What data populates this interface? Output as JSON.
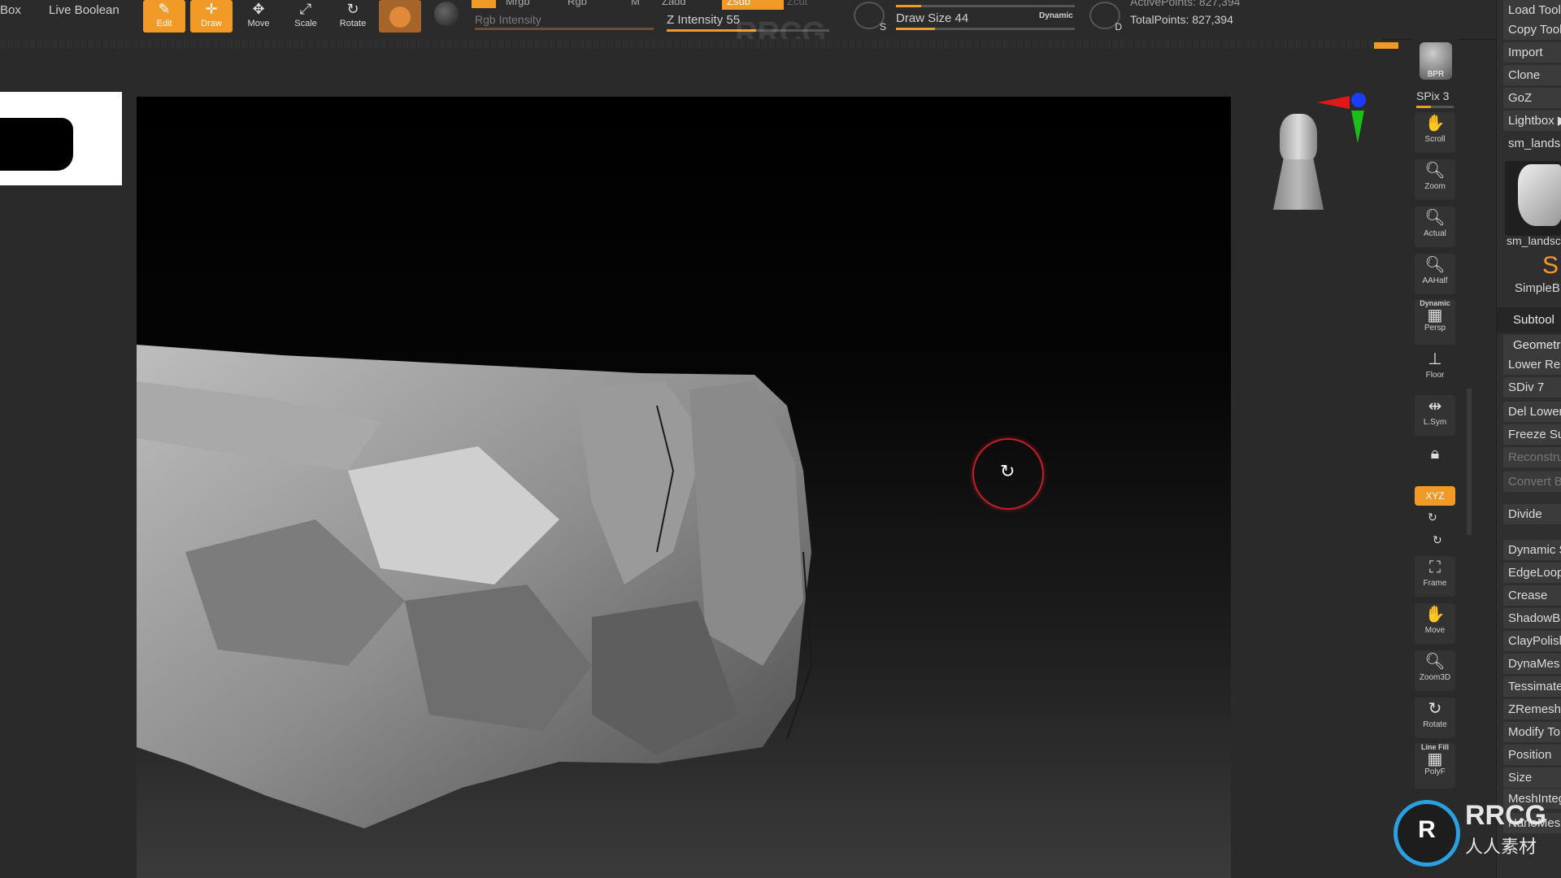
{
  "topbar": {
    "box_label": "Box",
    "live_boolean": "Live Boolean",
    "tools": [
      {
        "label": "Edit",
        "icon": "edit-icon",
        "active": true
      },
      {
        "label": "Draw",
        "icon": "draw-icon",
        "active": true
      },
      {
        "label": "Move",
        "icon": "move-icon",
        "active": false
      },
      {
        "label": "Scale",
        "icon": "scale-icon",
        "active": false
      },
      {
        "label": "Rotate",
        "icon": "rotate-icon",
        "active": false
      }
    ],
    "mrgb": "Mrgb",
    "rgb": "Rgb",
    "m": "M",
    "zadd": "Zadd",
    "zsub": "Zsub",
    "zcut": "Zcut",
    "rgb_intensity": "Rgb Intensity",
    "z_intensity": "Z Intensity 55",
    "draw_size": "Draw Size 44",
    "dynamic": "Dynamic",
    "focal_s": "S",
    "focal_d": "D",
    "active_points": "ActivePoints: 827,394",
    "total_points": "TotalPoints: 827,394",
    "brand_watermark": "RRCG"
  },
  "shelf": {
    "bpr": "BPR",
    "spix": "SPix 3",
    "buttons": [
      {
        "label": "Scroll",
        "icon": "scroll-icon"
      },
      {
        "label": "Zoom",
        "icon": "zoom-icon"
      },
      {
        "label": "Actual",
        "icon": "actual-icon"
      },
      {
        "label": "AAHalf",
        "icon": "aahalf-icon"
      },
      {
        "label": "Persp",
        "icon": "persp-icon",
        "top_label": "Dynamic"
      },
      {
        "label": "Floor",
        "icon": "floor-icon"
      },
      {
        "label": "L.Sym",
        "icon": "lsym-icon"
      },
      {
        "label": "",
        "icon": "lock-icon"
      },
      {
        "label": "Frame",
        "icon": "frame-icon"
      },
      {
        "label": "Move",
        "icon": "move-icon"
      },
      {
        "label": "Zoom3D",
        "icon": "zoom3d-icon"
      },
      {
        "label": "Rotate",
        "icon": "rotate-icon"
      },
      {
        "label": "PolyF",
        "icon": "polyf-icon",
        "top_label": "Line Fill"
      }
    ],
    "xyz": "XYZ"
  },
  "palette": {
    "items": [
      {
        "label": "Load Tool",
        "dim": false
      },
      {
        "label": "Copy Tool",
        "dim": false
      },
      {
        "label": "Import",
        "dim": false
      },
      {
        "label": "Clone",
        "dim": false
      },
      {
        "label": "GoZ",
        "dim": false
      },
      {
        "label": "Lightbox ▶",
        "dim": false
      },
      {
        "label": "sm_landsc",
        "dim": false
      }
    ],
    "thumb_label": "sm_landsc",
    "simple_label": "SimpleB",
    "subtool": "Subtool",
    "geometry": "Geometr",
    "geo_items": [
      {
        "label": "Lower Res",
        "dim": false
      },
      {
        "label": "SDiv 7",
        "dim": false
      },
      {
        "label": "Del Lower",
        "dim": false
      },
      {
        "label": "Freeze Su",
        "dim": false
      },
      {
        "label": "Reconstru",
        "dim": true
      },
      {
        "label": "Convert B",
        "dim": true
      },
      {
        "label": "Divide",
        "dim": false
      },
      {
        "label": "Dynamic S",
        "dim": false
      },
      {
        "label": "EdgeLoop",
        "dim": false
      },
      {
        "label": "Crease",
        "dim": false
      },
      {
        "label": "ShadowB",
        "dim": false
      },
      {
        "label": "ClayPolish",
        "dim": false
      },
      {
        "label": "DynaMes",
        "dim": false
      },
      {
        "label": "Tessimate",
        "dim": false
      },
      {
        "label": "ZRemesh",
        "dim": false
      },
      {
        "label": "Modify To",
        "dim": false
      },
      {
        "label": "Position",
        "dim": false
      },
      {
        "label": "Size",
        "dim": false
      },
      {
        "label": "MeshInteg",
        "dim": false
      },
      {
        "label": "NanoMes",
        "dim": false
      }
    ]
  },
  "logo": {
    "text": "RRCG",
    "subtext": "人人素材"
  },
  "colors": {
    "accent": "#f29a28",
    "panel": "#2b2b2b",
    "cursor_ring": "#c0202a"
  }
}
